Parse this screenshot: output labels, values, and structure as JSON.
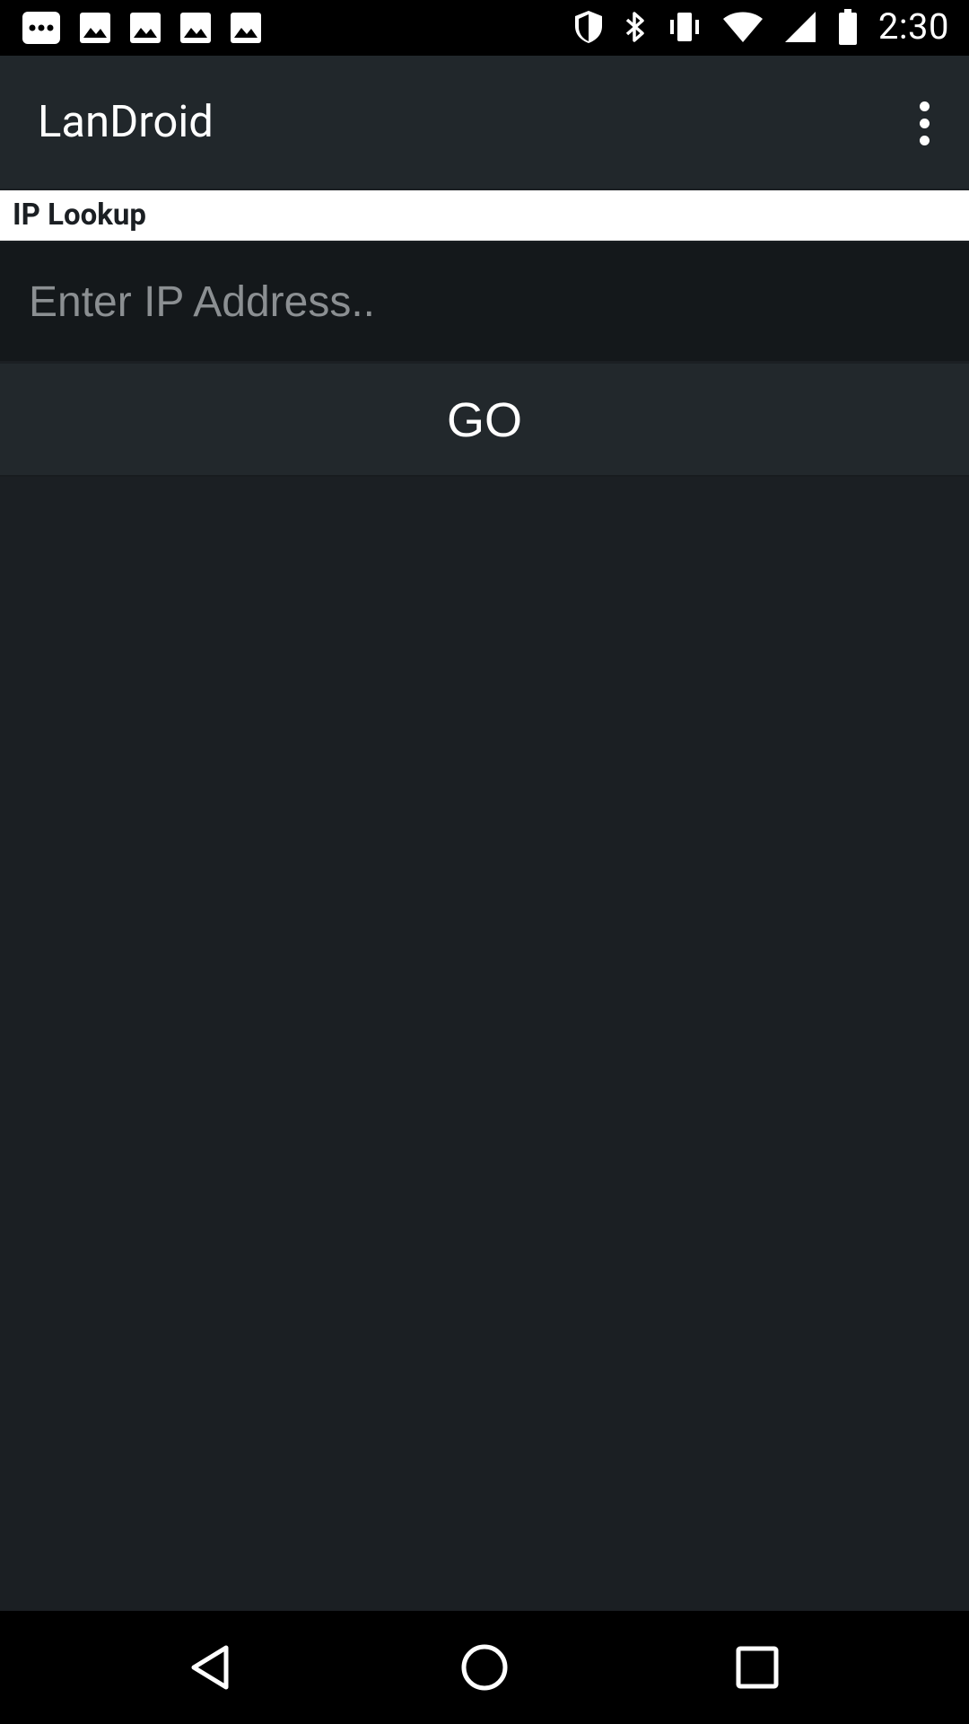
{
  "status_bar": {
    "time": "2:30",
    "left_icons": [
      "more-horiz-icon",
      "image-icon",
      "image-icon",
      "image-icon",
      "image-icon"
    ],
    "right_icons": [
      "shield-icon",
      "bluetooth-icon",
      "vibrate-icon",
      "wifi-icon",
      "signal-icon",
      "battery-icon"
    ]
  },
  "app_bar": {
    "title": "LanDroid",
    "overflow_icon": "more-vert-icon"
  },
  "section": {
    "title": "IP Lookup"
  },
  "ip_input": {
    "value": "",
    "placeholder": "Enter IP Address.."
  },
  "go_button": {
    "label": "GO"
  },
  "nav_bar": {
    "buttons": [
      "back-icon",
      "home-icon",
      "recents-icon"
    ]
  },
  "colors": {
    "background": "#1b1f23",
    "app_bar": "#21272b",
    "section_header": "#ffffff",
    "input_bg": "#14181b",
    "button_bg": "#22282c"
  }
}
